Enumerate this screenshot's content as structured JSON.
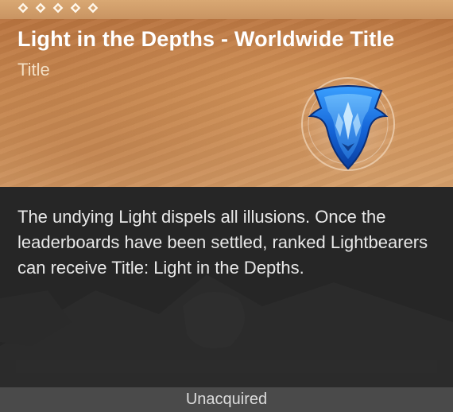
{
  "rarity": {
    "stars": 5
  },
  "item": {
    "name": "Light in the Depths - Worldwide Title",
    "type": "Title",
    "icon": "blue-shield-emblem-icon",
    "description": "The undying Light dispels all illusions. Once the leaderboards have been settled, ranked Lightbearers can receive Title: Light in the Depths."
  },
  "status": "Unacquired",
  "colors": {
    "header": "#c98a52",
    "body": "#262626",
    "footer": "#4a4a4a",
    "emblem": "#1a73e8"
  }
}
